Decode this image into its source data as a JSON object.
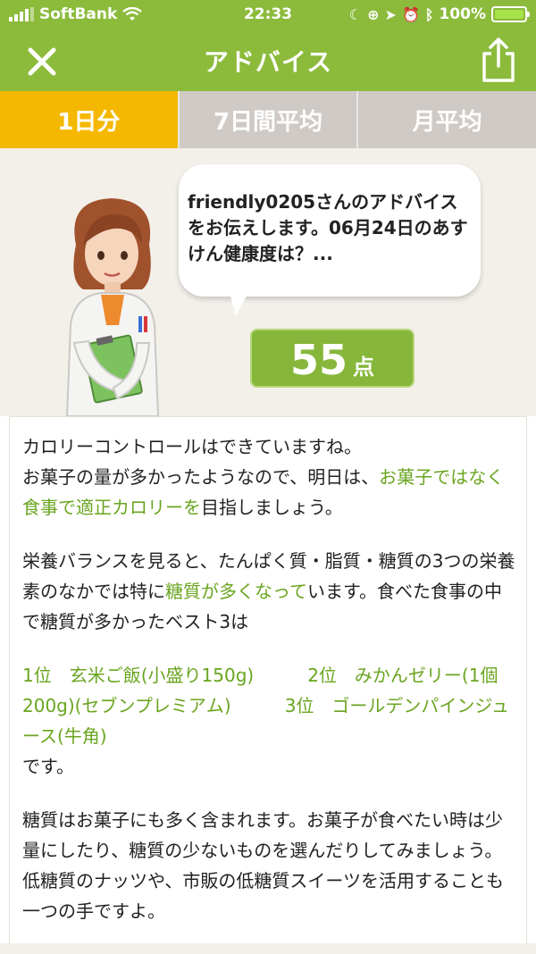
{
  "status_bar": {
    "carrier": "SoftBank",
    "time": "22:33",
    "battery": "100%",
    "battery_color": "#a6e24a"
  },
  "header": {
    "title": "アドバイス",
    "close_icon": "close-icon",
    "share_icon": "share-icon",
    "background_color": "#8cbb3c"
  },
  "tabs": [
    {
      "label": "1日分",
      "active": true
    },
    {
      "label": "7日間平均",
      "active": false
    },
    {
      "label": "月平均",
      "active": false
    }
  ],
  "bubble": {
    "text": "friendly0205さんのアドバイスをお伝えします。06月24日のあすけん健康度は？..."
  },
  "score": {
    "value": "55",
    "unit": "点"
  },
  "advice": {
    "p1_line1": "カロリーコントロールはできていますね。",
    "p1_a": "お菓子の量が多かったようなので、明日は、",
    "p1_hl": "お菓子ではなく食事で適正カロリーを",
    "p1_b": "目指しましょう。",
    "p2_a": "栄養バランスを見ると、たんぱく質・脂質・糖質の3つの栄養素のなかでは特に",
    "p2_hl": "糖質が多くなって",
    "p2_b": "います。食べた食事の中で糖質が多かったベスト3は",
    "rank1": "1位　玄米ご飯(小盛り150g)",
    "rank2": "2位　みかんゼリー(1個200g)(セブンプレミアム)",
    "rank3": "3位　ゴールデンパインジュース(牛角)",
    "p3_end": "です。",
    "p4": "糖質はお菓子にも多く含まれます。お菓子が食べたい時は少量にしたり、糖質の少ないものを選んだりしてみましょう。低糖質のナッツや、市販の低糖質スイーツを活用することも一つの手ですよ。",
    "highlight_color": "#6aa520"
  }
}
